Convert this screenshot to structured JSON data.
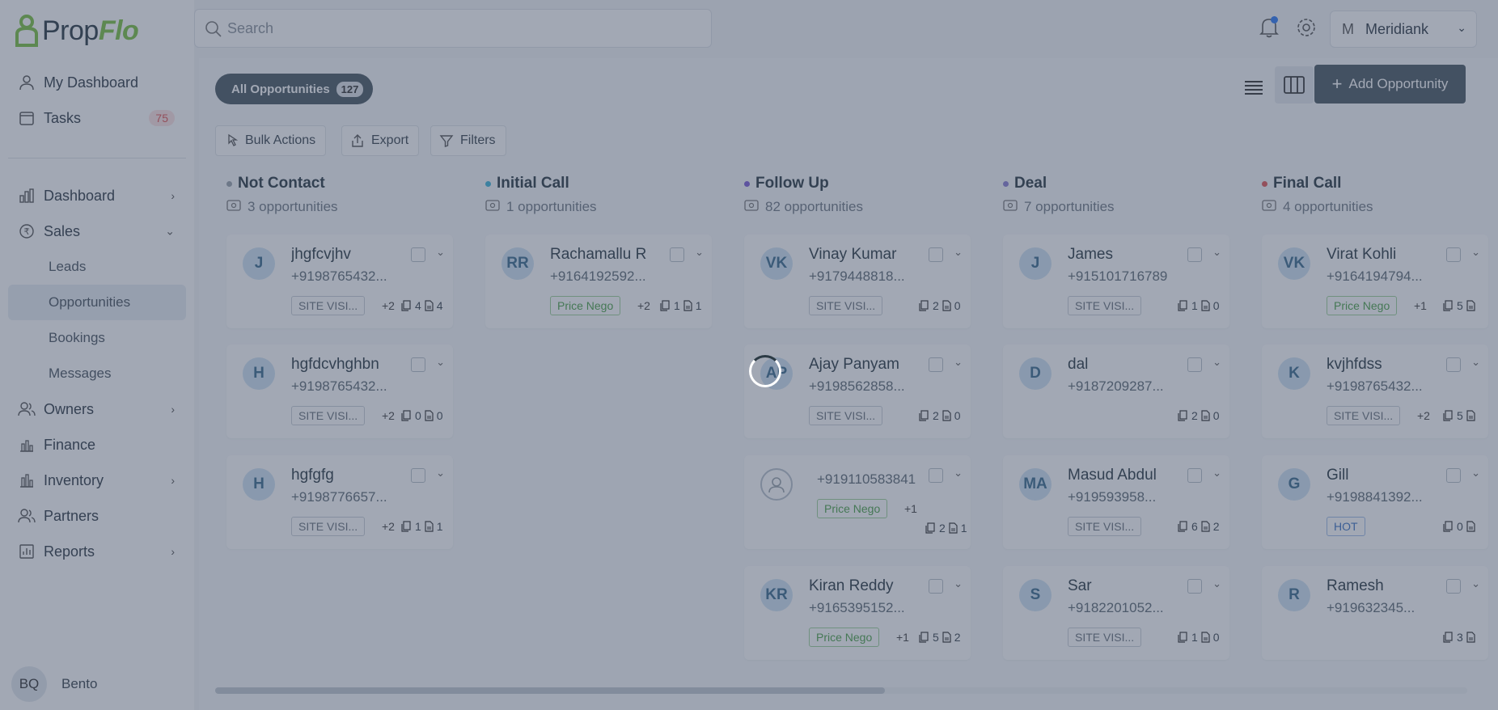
{
  "app": {
    "logo_main": "Prop",
    "logo_accent": "Flo"
  },
  "search": {
    "placeholder": "Search"
  },
  "account": {
    "initial": "M",
    "name": "Meridiank"
  },
  "sidebar": {
    "items": [
      {
        "label": "My Dashboard"
      },
      {
        "label": "Tasks",
        "badge": "75"
      },
      {
        "label": "Dashboard"
      },
      {
        "label": "Sales"
      },
      {
        "label": "Leads"
      },
      {
        "label": "Opportunities"
      },
      {
        "label": "Bookings"
      },
      {
        "label": "Messages"
      },
      {
        "label": "Owners"
      },
      {
        "label": "Finance"
      },
      {
        "label": "Inventory"
      },
      {
        "label": "Partners"
      },
      {
        "label": "Reports"
      }
    ],
    "user": {
      "initials": "BQ",
      "name": "Bento"
    }
  },
  "toolbar": {
    "all_label": "All Opportunities",
    "all_count": "127",
    "add_label": "Add Opportunity",
    "bulk_label": "Bulk Actions",
    "export_label": "Export",
    "filters_label": "Filters"
  },
  "columns": [
    {
      "title": "Not Contact",
      "sub": "3 opportunities",
      "dot_color": "#9aa3ab",
      "cards": [
        {
          "initials": "J",
          "name": "jhgfcvjhv",
          "phone": "+9198765432...",
          "tag": "SITE VISI...",
          "more": "+2",
          "c1": "4",
          "c2": "4"
        },
        {
          "initials": "H",
          "name": "hgfdcvhghbn",
          "phone": "+9198765432...",
          "tag": "SITE VISI...",
          "more": "+2",
          "c1": "0",
          "c2": "0"
        },
        {
          "initials": "H",
          "name": "hgfgfg",
          "phone": "+9198776657...",
          "tag": "SITE VISI...",
          "more": "+2",
          "c1": "1",
          "c2": "1"
        }
      ]
    },
    {
      "title": "Initial Call",
      "sub": "1 opportunities",
      "dot_color": "#3cb4d8",
      "cards": [
        {
          "initials": "RR",
          "name": "Rachamallu R",
          "phone": "+9164192592...",
          "tag": "Price Nego",
          "more": "+2",
          "c1": "1",
          "c2": "1"
        }
      ]
    },
    {
      "title": "Follow Up",
      "sub": "82 opportunities",
      "dot_color": "#7b5cd6",
      "cards": [
        {
          "initials": "VK",
          "name": "Vinay Kumar",
          "phone": "+9179448818...",
          "tag": "SITE VISI...",
          "more": "",
          "c1": "2",
          "c2": "0"
        },
        {
          "initials": "AP",
          "name": "Ajay Panyam",
          "phone": "+9198562858...",
          "tag": "SITE VISI...",
          "more": "",
          "c1": "2",
          "c2": "0"
        },
        {
          "initials": "",
          "name": "",
          "phone": "+919110583841",
          "tag": "Price Nego",
          "more": "+1",
          "c1": "2",
          "c2": "1"
        },
        {
          "initials": "KR",
          "name": "Kiran Reddy",
          "phone": "+9165395152...",
          "tag": "Price Nego",
          "more": "+1",
          "c1": "5",
          "c2": "2"
        }
      ]
    },
    {
      "title": "Deal",
      "sub": "7 opportunities",
      "dot_color": "#8a7fd4",
      "cards": [
        {
          "initials": "J",
          "name": "James",
          "phone": "+915101716789",
          "tag": "SITE VISI...",
          "more": "",
          "c1": "1",
          "c2": "0"
        },
        {
          "initials": "D",
          "name": "dal",
          "phone": "+9187209287...",
          "tag": "",
          "more": "",
          "c1": "2",
          "c2": "0"
        },
        {
          "initials": "MA",
          "name": "Masud Abdul",
          "phone": "+919593958...",
          "tag": "SITE VISI...",
          "more": "",
          "c1": "6",
          "c2": "2"
        },
        {
          "initials": "S",
          "name": "Sar",
          "phone": "+9182201052...",
          "tag": "SITE VISI...",
          "more": "",
          "c1": "1",
          "c2": "0"
        }
      ]
    },
    {
      "title": "Final Call",
      "sub": "4 opportunities",
      "dot_color": "#e25656",
      "cards": [
        {
          "initials": "VK",
          "name": "Virat Kohli",
          "phone": "+9164194794...",
          "tag": "Price Nego",
          "more": "+1",
          "c1": "5",
          "c2": ""
        },
        {
          "initials": "K",
          "name": "kvjhfdss",
          "phone": "+9198765432...",
          "tag": "SITE VISI...",
          "more": "+2",
          "c1": "5",
          "c2": ""
        },
        {
          "initials": "G",
          "name": "Gill",
          "phone": "+9198841392...",
          "tag": "HOT",
          "more": "",
          "c1": "0",
          "c2": ""
        },
        {
          "initials": "R",
          "name": "Ramesh",
          "phone": "+919632345...",
          "tag": "",
          "more": "",
          "c1": "3",
          "c2": ""
        }
      ]
    }
  ],
  "colors": {
    "overlay": "#3c4a62",
    "primary": "#4a5863",
    "accent_green": "#7cc142"
  },
  "status": {
    "loading": true
  }
}
